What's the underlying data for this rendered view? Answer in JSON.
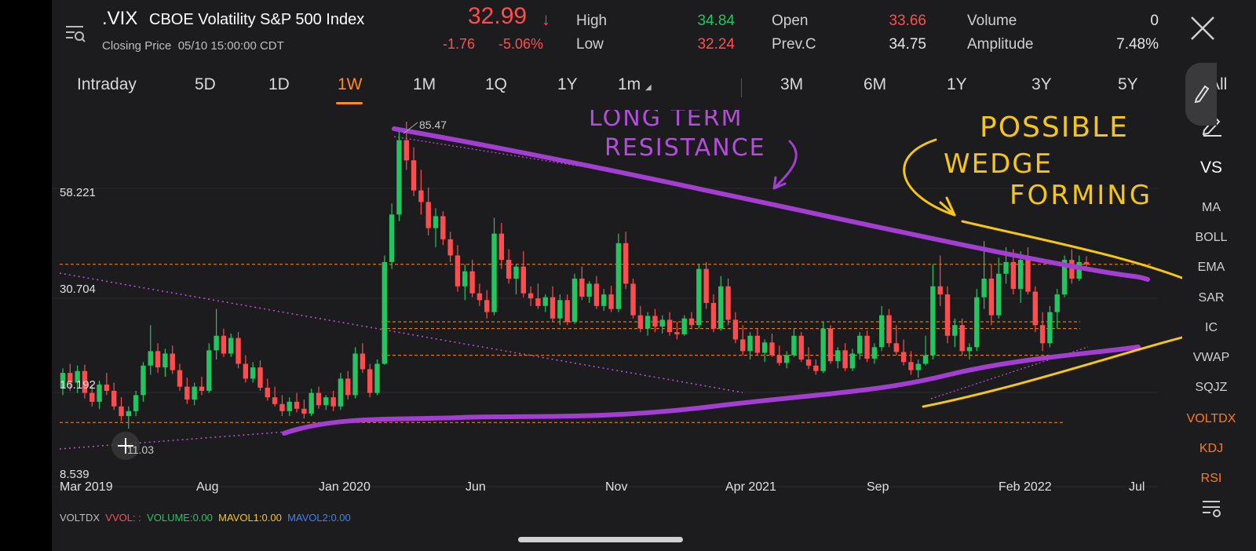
{
  "header": {
    "symbol": ".VIX",
    "name": "CBOE Volatility S&P 500 Index",
    "closing_label": "Closing Price",
    "closing_time": "05/10 15:00:00 CDT",
    "price": "32.99",
    "change": "-1.76",
    "change_pct": "-5.06%",
    "stats": [
      {
        "label": "High",
        "value": "34.84",
        "color": "#22c55e"
      },
      {
        "label": "Low",
        "value": "32.24",
        "color": "#ff4d4f"
      },
      {
        "label": "Open",
        "value": "33.66",
        "color": "#ff4d4f"
      },
      {
        "label": "Prev.C",
        "value": "34.75",
        "color": "#e6e6e6"
      },
      {
        "label": "Volume",
        "value": "0",
        "color": "#e6e6e6"
      },
      {
        "label": "Amplitude",
        "value": "7.48%",
        "color": "#e6e6e6"
      }
    ]
  },
  "tabs": [
    "Intraday",
    "5D",
    "1D",
    "1W",
    "1M",
    "1Q",
    "1Y",
    "1m",
    "3M",
    "6M",
    "1Y",
    "3Y",
    "5Y",
    "All"
  ],
  "active_tab": "1W",
  "side_menu": [
    "VS",
    "MA",
    "BOLL",
    "EMA",
    "SAR",
    "IC",
    "VWAP",
    "SQJZ",
    "VOLTDX",
    "KDJ",
    "RSI"
  ],
  "legend": {
    "voltdx": "VOLTDX",
    "vvol": "VVOL: :",
    "volume": "VOLUME:0.00",
    "mavol1": "MAVOL1:0.00",
    "mavol2": "MAVOL2:0.00"
  },
  "annotations": {
    "resistance": "LONG TERM RESISTANCE",
    "wedge": "POSSIBLE WEDGE FORMING"
  },
  "colors": {
    "accent": "#ff8a1f",
    "up": "#22c55e",
    "down": "#ff4d4f",
    "trendline": "#a23fd0",
    "wedge": "#f5c518"
  },
  "chart_data": {
    "type": "candlestick",
    "y_ticks": [
      "58.221",
      "30.704",
      "16.192",
      "8.539"
    ],
    "y_scale": "log",
    "x_ticks": [
      "Mar 2019",
      "Aug",
      "Jan 2020",
      "Jun",
      "Nov",
      "Apr 2021",
      "Sep",
      "Feb 2022",
      "Jul"
    ],
    "annotations": [
      {
        "label": "85.47",
        "note": "high"
      },
      {
        "label": "11.03",
        "note": "low"
      }
    ],
    "reference_levels": [
      33.0,
      22.5,
      21.5,
      18.0,
      11.5
    ],
    "series": [
      {
        "values": [
          [
            14.5,
            16.5,
            13.8,
            16.0
          ],
          [
            16.0,
            17.0,
            14.2,
            15.0
          ],
          [
            15.0,
            16.8,
            14.0,
            16.2
          ],
          [
            16.2,
            16.9,
            13.5,
            14.0
          ],
          [
            14.0,
            14.8,
            12.8,
            13.2
          ],
          [
            13.2,
            15.2,
            12.6,
            14.8
          ],
          [
            14.8,
            16.0,
            13.8,
            14.2
          ],
          [
            14.2,
            15.0,
            12.5,
            12.8
          ],
          [
            12.8,
            13.6,
            11.6,
            12.0
          ],
          [
            12.0,
            12.8,
            11.03,
            12.4
          ],
          [
            12.4,
            14.2,
            12.0,
            13.8
          ],
          [
            13.8,
            17.2,
            13.2,
            16.8
          ],
          [
            16.8,
            22.0,
            15.8,
            18.5
          ],
          [
            18.5,
            19.5,
            16.0,
            16.6
          ],
          [
            16.6,
            18.8,
            15.6,
            18.2
          ],
          [
            18.2,
            19.2,
            15.9,
            16.3
          ],
          [
            16.3,
            17.0,
            14.2,
            14.6
          ],
          [
            14.6,
            15.5,
            13.0,
            13.4
          ],
          [
            13.4,
            15.0,
            12.9,
            14.6
          ],
          [
            14.6,
            15.6,
            13.8,
            14.2
          ],
          [
            14.2,
            19.5,
            14.0,
            18.6
          ],
          [
            18.6,
            24.5,
            17.5,
            20.5
          ],
          [
            20.5,
            21.5,
            17.8,
            18.2
          ],
          [
            18.2,
            20.8,
            17.8,
            20.2
          ],
          [
            20.2,
            21.0,
            16.5,
            17.0
          ],
          [
            17.0,
            18.0,
            15.0,
            15.4
          ],
          [
            15.4,
            17.2,
            15.0,
            16.6
          ],
          [
            16.6,
            17.4,
            14.2,
            14.5
          ],
          [
            14.5,
            15.4,
            13.3,
            13.6
          ],
          [
            13.6,
            14.6,
            12.8,
            13.0
          ],
          [
            13.0,
            13.8,
            12.0,
            12.4
          ],
          [
            12.4,
            13.6,
            12.0,
            13.2
          ],
          [
            13.2,
            14.0,
            12.3,
            12.6
          ],
          [
            12.6,
            13.4,
            11.8,
            12.2
          ],
          [
            12.2,
            14.4,
            12.0,
            14.0
          ],
          [
            14.0,
            14.6,
            12.6,
            12.9
          ],
          [
            12.9,
            13.8,
            12.5,
            13.6
          ],
          [
            13.6,
            14.2,
            12.4,
            12.8
          ],
          [
            12.8,
            16.0,
            12.5,
            15.4
          ],
          [
            15.4,
            16.2,
            13.4,
            13.8
          ],
          [
            13.8,
            19.0,
            13.5,
            18.2
          ],
          [
            18.2,
            19.5,
            16.0,
            16.4
          ],
          [
            16.4,
            17.0,
            13.6,
            14.0
          ],
          [
            14.0,
            17.5,
            13.8,
            17.0
          ],
          [
            17.0,
            35.0,
            16.9,
            33.5
          ],
          [
            33.5,
            49.5,
            32.0,
            46.0
          ],
          [
            46.0,
            82.0,
            44.0,
            75.5
          ],
          [
            75.5,
            85.47,
            62.0,
            66.0
          ],
          [
            66.0,
            72.0,
            52.0,
            54.0
          ],
          [
            54.0,
            62.0,
            46.0,
            50.0
          ],
          [
            50.0,
            55.0,
            40.0,
            42.0
          ],
          [
            42.0,
            48.0,
            37.0,
            45.5
          ],
          [
            45.5,
            47.0,
            37.5,
            39.0
          ],
          [
            39.0,
            41.0,
            33.5,
            35.0
          ],
          [
            35.0,
            37.5,
            27.5,
            28.5
          ],
          [
            28.5,
            33.0,
            26.0,
            31.5
          ],
          [
            31.5,
            34.0,
            26.5,
            27.2
          ],
          [
            27.2,
            29.0,
            25.0,
            26.0
          ],
          [
            26.0,
            27.8,
            23.0,
            24.0
          ],
          [
            24.0,
            45.0,
            23.5,
            40.5
          ],
          [
            40.5,
            43.5,
            32.0,
            34.0
          ],
          [
            34.0,
            36.5,
            29.0,
            30.0
          ],
          [
            30.0,
            33.0,
            27.0,
            32.5
          ],
          [
            32.5,
            36.0,
            26.5,
            27.2
          ],
          [
            27.2,
            28.5,
            25.0,
            26.3
          ],
          [
            26.3,
            29.0,
            24.5,
            25.0
          ],
          [
            25.0,
            27.0,
            24.0,
            26.5
          ],
          [
            26.5,
            28.5,
            22.5,
            23.0
          ],
          [
            23.0,
            27.0,
            22.0,
            26.0
          ],
          [
            26.0,
            27.0,
            22.0,
            22.5
          ],
          [
            22.5,
            31.0,
            22.2,
            30.0
          ],
          [
            30.0,
            32.5,
            26.0,
            26.6
          ],
          [
            26.6,
            29.5,
            25.5,
            29.0
          ],
          [
            29.0,
            30.5,
            24.5,
            25.0
          ],
          [
            25.0,
            28.0,
            24.2,
            27.0
          ],
          [
            27.0,
            28.6,
            24.0,
            24.5
          ],
          [
            24.5,
            40.5,
            24.0,
            38.0
          ],
          [
            38.0,
            41.0,
            28.0,
            29.0
          ],
          [
            29.0,
            30.0,
            23.0,
            23.5
          ],
          [
            23.5,
            25.0,
            21.0,
            21.5
          ],
          [
            21.5,
            24.0,
            20.5,
            23.4
          ],
          [
            23.4,
            24.5,
            21.0,
            21.8
          ],
          [
            21.8,
            23.5,
            20.8,
            22.8
          ],
          [
            22.8,
            24.0,
            20.5,
            21.0
          ],
          [
            21.0,
            22.5,
            20.0,
            20.7
          ],
          [
            20.7,
            23.5,
            20.5,
            23.0
          ],
          [
            23.0,
            24.0,
            21.5,
            22.0
          ],
          [
            22.0,
            33.0,
            21.5,
            32.0
          ],
          [
            32.0,
            33.5,
            24.5,
            25.5
          ],
          [
            25.5,
            27.0,
            21.0,
            21.5
          ],
          [
            21.5,
            30.5,
            21.2,
            28.5
          ],
          [
            28.5,
            30.0,
            22.0,
            22.8
          ],
          [
            22.8,
            24.0,
            19.5,
            20.0
          ],
          [
            20.0,
            22.0,
            18.0,
            18.5
          ],
          [
            18.5,
            21.0,
            17.5,
            20.5
          ],
          [
            20.5,
            21.5,
            18.0,
            18.3
          ],
          [
            18.3,
            20.0,
            17.2,
            19.6
          ],
          [
            19.6,
            20.8,
            17.8,
            18.0
          ],
          [
            18.0,
            19.2,
            16.8,
            17.1
          ],
          [
            17.1,
            18.5,
            16.5,
            18.0
          ],
          [
            18.0,
            21.5,
            17.8,
            20.5
          ],
          [
            20.5,
            21.0,
            17.2,
            17.5
          ],
          [
            17.5,
            19.0,
            16.4,
            16.8
          ],
          [
            16.8,
            17.5,
            15.8,
            16.2
          ],
          [
            16.2,
            22.5,
            16.0,
            21.5
          ],
          [
            21.5,
            22.0,
            17.0,
            17.3
          ],
          [
            17.3,
            19.0,
            16.5,
            18.6
          ],
          [
            18.6,
            19.5,
            16.2,
            16.5
          ],
          [
            16.5,
            18.8,
            16.2,
            18.2
          ],
          [
            18.2,
            21.0,
            17.5,
            20.5
          ],
          [
            20.5,
            21.2,
            17.2,
            17.6
          ],
          [
            17.6,
            19.5,
            17.0,
            19.0
          ],
          [
            19.0,
            25.0,
            18.5,
            23.5
          ],
          [
            23.5,
            24.5,
            19.0,
            19.5
          ],
          [
            19.5,
            22.0,
            18.0,
            18.4
          ],
          [
            18.4,
            20.0,
            16.8,
            17.2
          ],
          [
            17.2,
            18.5,
            15.8,
            16.3
          ],
          [
            16.3,
            17.5,
            15.5,
            17.0
          ],
          [
            17.0,
            20.5,
            16.8,
            18.0
          ],
          [
            18.0,
            33.0,
            17.5,
            28.5
          ],
          [
            28.5,
            35.0,
            25.0,
            27.0
          ],
          [
            27.0,
            28.5,
            19.5,
            20.5
          ],
          [
            20.5,
            23.0,
            19.0,
            22.0
          ],
          [
            22.0,
            23.0,
            18.0,
            18.5
          ],
          [
            18.5,
            19.5,
            17.5,
            19.0
          ],
          [
            19.0,
            28.0,
            18.5,
            26.5
          ],
          [
            26.5,
            38.5,
            24.5,
            30.0
          ],
          [
            30.0,
            33.0,
            22.0,
            23.5
          ],
          [
            23.5,
            34.5,
            23.0,
            31.0
          ],
          [
            31.0,
            37.0,
            29.0,
            33.5
          ],
          [
            33.5,
            36.5,
            27.0,
            28.0
          ],
          [
            28.0,
            36.0,
            25.5,
            34.0
          ],
          [
            34.0,
            37.0,
            27.0,
            27.5
          ],
          [
            27.5,
            28.5,
            21.0,
            22.0
          ],
          [
            22.0,
            24.0,
            18.5,
            19.5
          ],
          [
            19.5,
            25.0,
            19.0,
            24.0
          ],
          [
            24.0,
            28.0,
            21.5,
            27.0
          ],
          [
            27.0,
            35.0,
            26.5,
            34.0
          ],
          [
            34.0,
            36.5,
            29.0,
            30.0
          ],
          [
            30.0,
            35.0,
            29.5,
            33.5
          ],
          [
            33.5,
            34.84,
            32.24,
            32.99
          ]
        ]
      }
    ]
  }
}
